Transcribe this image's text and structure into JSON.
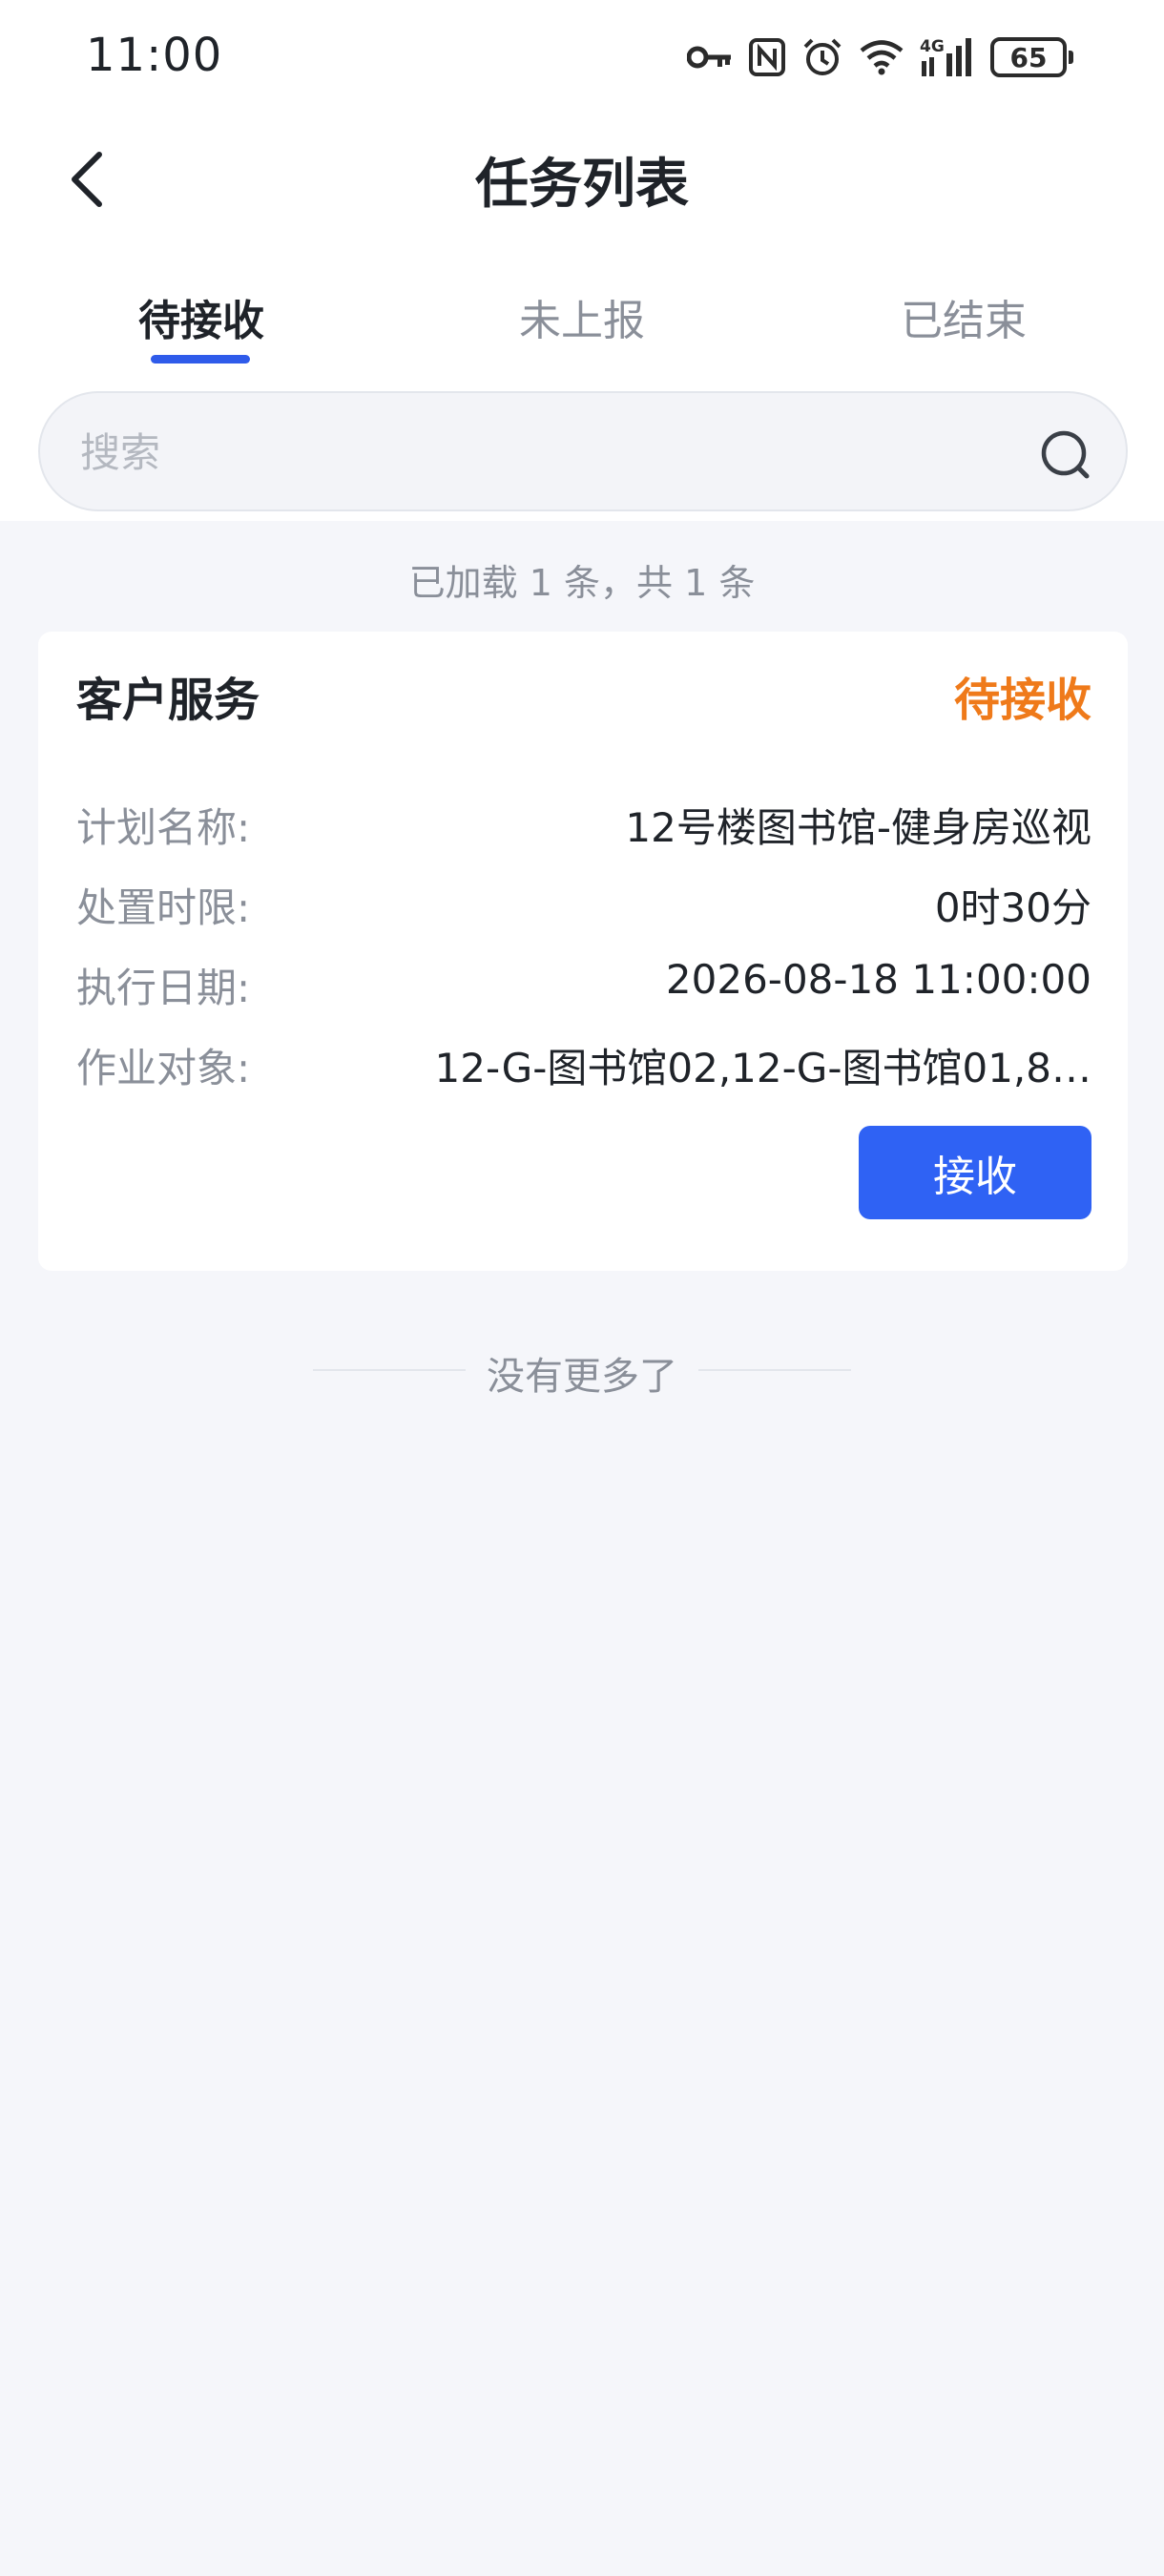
{
  "status_bar": {
    "time": "11:00",
    "battery": "65",
    "network": "4G",
    "icons": [
      "key-icon",
      "nfc-icon",
      "alarm-icon",
      "wifi-icon",
      "signal-icon",
      "battery-icon"
    ]
  },
  "header": {
    "title": "任务列表",
    "back_icon": "chevron-left-icon"
  },
  "tabs": [
    {
      "label": "待接收",
      "active": true
    },
    {
      "label": "未上报",
      "active": false
    },
    {
      "label": "已结束",
      "active": false
    }
  ],
  "search": {
    "placeholder": "搜索",
    "value": "",
    "icon": "search-icon"
  },
  "list_info": "已加载 1 条，共 1 条",
  "tasks": [
    {
      "title": "客户服务",
      "status": "待接收",
      "fields": [
        {
          "label": "计划名称:",
          "value": "12号楼图书馆-健身房巡视"
        },
        {
          "label": "处置时限:",
          "value": "0时30分"
        },
        {
          "label": "执行日期:",
          "value": "2026-08-18 11:00:00"
        },
        {
          "label": "作业对象:",
          "value": "12-G-图书馆02,12-G-图书馆01,8…"
        }
      ],
      "action_label": "接收"
    }
  ],
  "list_end": "没有更多了",
  "colors": {
    "accent": "#2f62f4",
    "tab_indicator": "#2f5bea",
    "status_pending": "#ef7a1a",
    "page_background": "#f5f6fa",
    "muted_text": "#8a8f99"
  }
}
